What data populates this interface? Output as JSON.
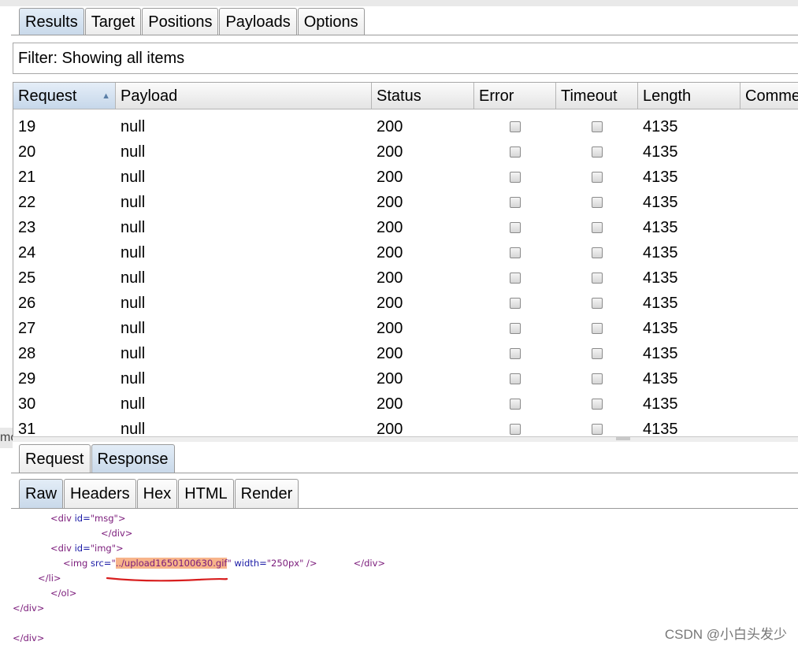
{
  "main_tabs": [
    "Results",
    "Target",
    "Positions",
    "Payloads",
    "Options"
  ],
  "filter": {
    "text": "Filter: Showing all items"
  },
  "table": {
    "columns": [
      "Request",
      "Payload",
      "Status",
      "Error",
      "Timeout",
      "Length",
      "Comme"
    ],
    "sorted_column": "Request",
    "rows": [
      {
        "request": "19",
        "payload": "null",
        "status": "200",
        "error": false,
        "timeout": false,
        "length": "4135"
      },
      {
        "request": "20",
        "payload": "null",
        "status": "200",
        "error": false,
        "timeout": false,
        "length": "4135"
      },
      {
        "request": "21",
        "payload": "null",
        "status": "200",
        "error": false,
        "timeout": false,
        "length": "4135"
      },
      {
        "request": "22",
        "payload": "null",
        "status": "200",
        "error": false,
        "timeout": false,
        "length": "4135"
      },
      {
        "request": "23",
        "payload": "null",
        "status": "200",
        "error": false,
        "timeout": false,
        "length": "4135"
      },
      {
        "request": "24",
        "payload": "null",
        "status": "200",
        "error": false,
        "timeout": false,
        "length": "4135"
      },
      {
        "request": "25",
        "payload": "null",
        "status": "200",
        "error": false,
        "timeout": false,
        "length": "4135"
      },
      {
        "request": "26",
        "payload": "null",
        "status": "200",
        "error": false,
        "timeout": false,
        "length": "4135"
      },
      {
        "request": "27",
        "payload": "null",
        "status": "200",
        "error": false,
        "timeout": false,
        "length": "4135"
      },
      {
        "request": "28",
        "payload": "null",
        "status": "200",
        "error": false,
        "timeout": false,
        "length": "4135"
      },
      {
        "request": "29",
        "payload": "null",
        "status": "200",
        "error": false,
        "timeout": false,
        "length": "4135"
      },
      {
        "request": "30",
        "payload": "null",
        "status": "200",
        "error": false,
        "timeout": false,
        "length": "4135"
      },
      {
        "request": "31",
        "payload": "null",
        "status": "200",
        "error": false,
        "timeout": false,
        "length": "4135"
      }
    ]
  },
  "left_hint": "mc",
  "detail_tabs": [
    "Request",
    "Response"
  ],
  "view_tabs": [
    "Raw",
    "Headers",
    "Hex",
    "HTML",
    "Render"
  ],
  "code": {
    "line1_tag": "<div",
    "line1_attr": " id=",
    "line1_val": "\"msg\"",
    "line1_end": ">",
    "line2": "</div>",
    "line3_tag": "<div",
    "line3_attr": " id=",
    "line3_val": "\"img\"",
    "line3_end": ">",
    "line4_tag": "<img",
    "line4_src_attr": " src=",
    "line4_q1": "\"",
    "line4_highlight": "../upload1650100630.gif",
    "line4_q2": "\"",
    "line4_width_attr": " width=",
    "line4_width_val": "\"250px\"",
    "line4_close": " />",
    "line4_enddiv": "</div>",
    "line5": "</li>",
    "line6": "</ol>",
    "line7": "</div>",
    "line8": "</div>"
  },
  "colors": {
    "highlight": "#f7b48a",
    "annotation": "#d81e1e",
    "tag": "#7a1a7a",
    "attr": "#1a1aa6"
  },
  "watermark": "CSDN @小白头发少"
}
